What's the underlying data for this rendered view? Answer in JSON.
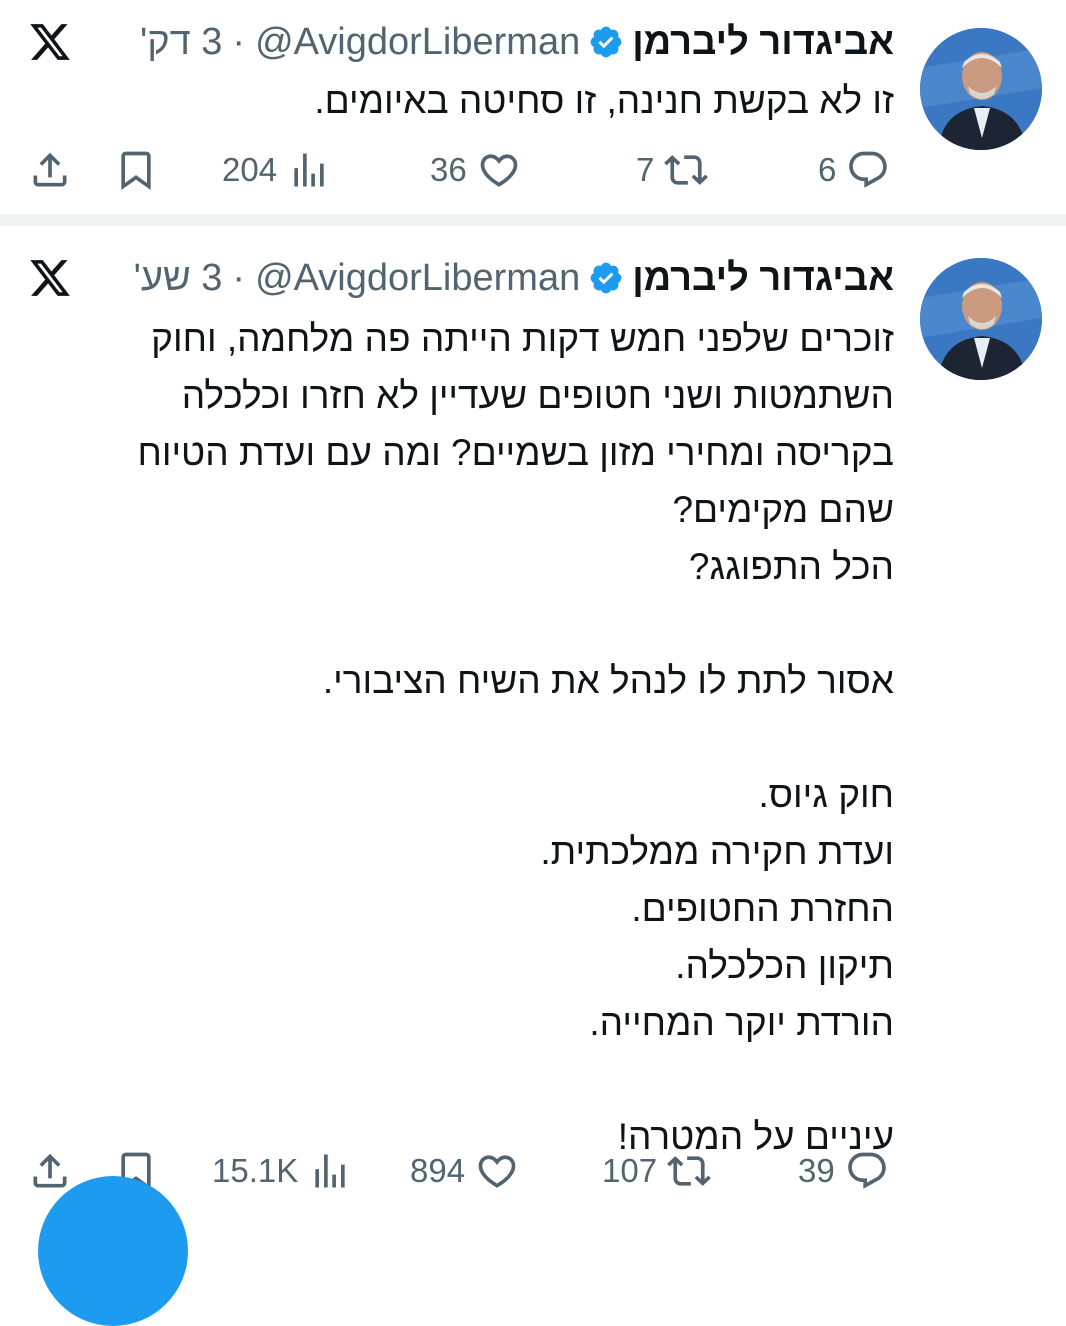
{
  "tweets": [
    {
      "author_name": "אביגדור ליברמן",
      "handle": "@AvigdorLiberman",
      "separator": "·",
      "time": "3 דק'",
      "lines": [
        "זו לא בקשת חנינה, זו סחיטה באיומים."
      ],
      "replies": "6",
      "retweets": "7",
      "likes": "36",
      "views": "204"
    },
    {
      "author_name": "אביגדור ליברמן",
      "handle": "@AvigdorLiberman",
      "separator": "·",
      "time": "3 שע'",
      "lines": [
        "זוכרים שלפני חמש דקות הייתה פה מלחמה, וחוק",
        "השתמטות ושני חטופים שעדיין לא חזרו וכלכלה",
        "בקריסה ומחירי מזון בשמיים? ומה עם ועדת הטיוח",
        "שהם מקימים?",
        "הכל התפוגג?",
        "",
        "אסור לתת לו לנהל את השיח הציבורי.",
        "",
        "חוק גיוס.",
        "ועדת חקירה ממלכתית.",
        "החזרת החטופים.",
        "תיקון הכלכלה.",
        "הורדת יוקר המחייה.",
        "",
        "עיניים על המטרה!"
      ],
      "replies": "39",
      "retweets": "107",
      "likes": "894",
      "views": "15.1K"
    }
  ],
  "icons": {
    "verified": "verified-badge-icon",
    "platform": "x-logo-icon",
    "reply": "reply-icon",
    "retweet": "retweet-icon",
    "like": "heart-icon",
    "views": "views-icon",
    "bookmark": "bookmark-icon",
    "share": "share-icon"
  },
  "colors": {
    "text": "#0f1419",
    "muted": "#536471",
    "verified": "#1d9bf0",
    "separator": "#eff3f4"
  }
}
